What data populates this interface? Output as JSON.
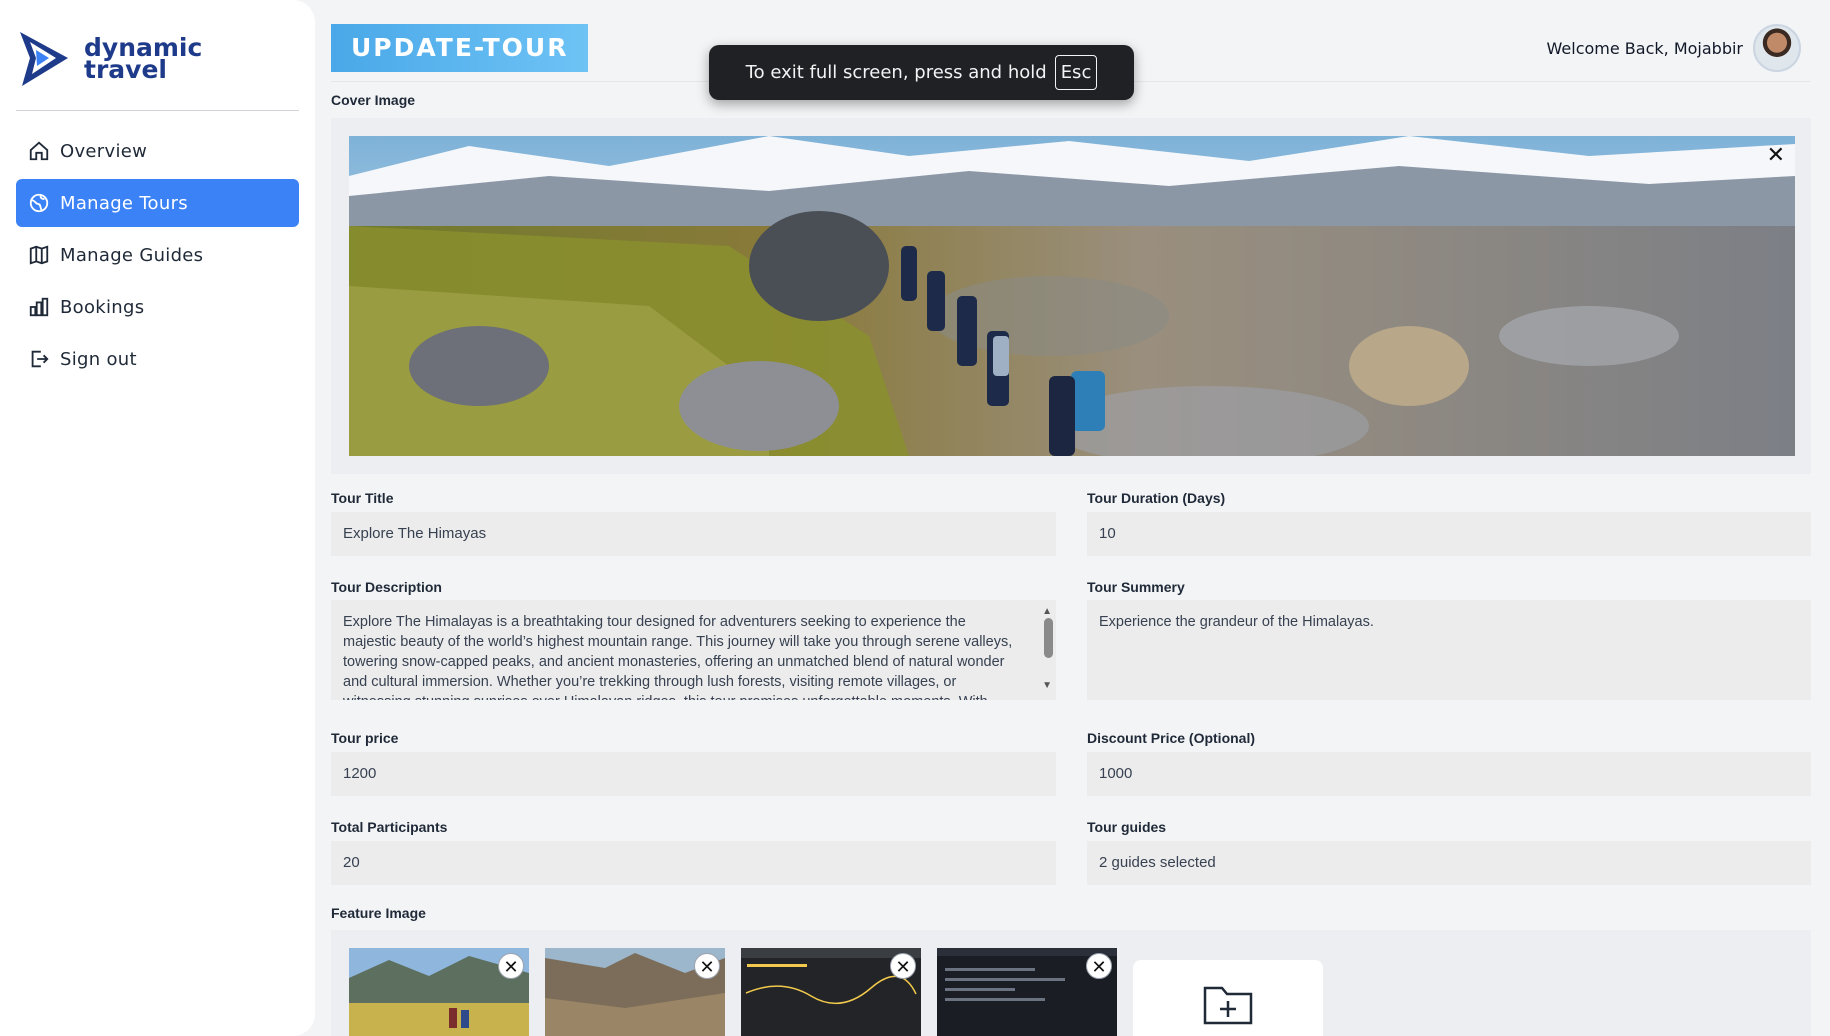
{
  "sidebar": {
    "brand_line1": "dynamic",
    "brand_line2": "travel",
    "items": [
      {
        "label": "Overview",
        "icon": "home-icon",
        "active": false
      },
      {
        "label": "Manage Tours",
        "icon": "globe-icon",
        "active": true
      },
      {
        "label": "Manage Guides",
        "icon": "map-icon",
        "active": false
      },
      {
        "label": "Bookings",
        "icon": "bar-chart-icon",
        "active": false
      },
      {
        "label": "Sign out",
        "icon": "sign-out-icon",
        "active": false
      }
    ]
  },
  "header": {
    "title": "UPDATE-TOUR",
    "welcome": "Welcome Back, Mojabbir"
  },
  "toast": {
    "text": "To exit full screen, press and hold",
    "key": "Esc"
  },
  "form": {
    "cover_label": "Cover Image",
    "title_label": "Tour Title",
    "title_value": "Explore The Himayas",
    "duration_label": "Tour Duration (Days)",
    "duration_value": "10",
    "description_label": "Tour Description",
    "description_value": "Explore The Himalayas is a breathtaking tour designed for adventurers seeking to experience the majestic beauty of the world’s highest mountain range. This journey will take you through serene valleys, towering snow-capped peaks, and ancient monasteries, offering an unmatched blend of natural wonder and cultural immersion. Whether you’re trekking through lush forests, visiting remote villages, or witnessing stunning sunrises over Himalayan ridges, this tour promises unforgettable moments. With expert guides leading the",
    "summary_label": "Tour Summery",
    "summary_value": "Experience the grandeur of the Himalayas.",
    "price_label": "Tour price",
    "price_value": "1200",
    "discount_label": "Discount Price (Optional)",
    "discount_value": "1000",
    "participants_label": "Total Participants",
    "participants_value": "20",
    "guides_label": "Tour guides",
    "guides_value": "2 guides selected",
    "feature_label": "Feature Image"
  },
  "colors": {
    "accent": "#3b82f6",
    "brand": "#1e3a8a",
    "title_gradient_start": "#4aa8e8",
    "title_gradient_end": "#6ec3f5"
  }
}
